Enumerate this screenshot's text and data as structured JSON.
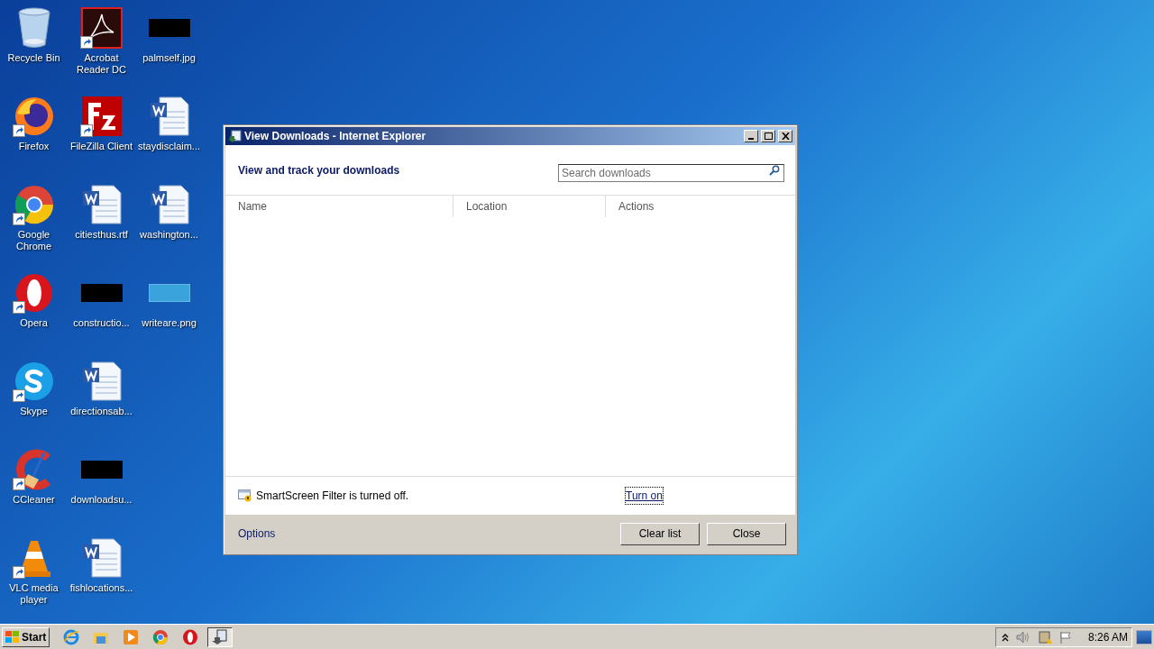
{
  "desktop_icons": [
    {
      "label": "Recycle Bin",
      "kind": "recycle",
      "shortcut": false
    },
    {
      "label": "Firefox",
      "kind": "firefox",
      "shortcut": true
    },
    {
      "label": "Google Chrome",
      "kind": "chrome",
      "shortcut": true
    },
    {
      "label": "Opera",
      "kind": "opera",
      "shortcut": true
    },
    {
      "label": "Skype",
      "kind": "skype",
      "shortcut": true
    },
    {
      "label": "CCleaner",
      "kind": "ccleaner",
      "shortcut": true
    },
    {
      "label": "VLC media player",
      "kind": "vlc",
      "shortcut": true
    },
    {
      "label": "Acrobat Reader DC",
      "kind": "acrobat",
      "shortcut": true
    },
    {
      "label": "FileZilla Client",
      "kind": "filezilla",
      "shortcut": true
    },
    {
      "label": "citiesthus.rtf",
      "kind": "word",
      "shortcut": false
    },
    {
      "label": "constructio...",
      "kind": "dark-image",
      "shortcut": false
    },
    {
      "label": "directionsab...",
      "kind": "word",
      "shortcut": false
    },
    {
      "label": "downloadsu...",
      "kind": "dark-image",
      "shortcut": false
    },
    {
      "label": "fishlocations...",
      "kind": "word",
      "shortcut": false
    },
    {
      "label": "palmself.jpg",
      "kind": "dark-image",
      "shortcut": false
    },
    {
      "label": "staydisclaim...",
      "kind": "word",
      "shortcut": false
    },
    {
      "label": "washington...",
      "kind": "word",
      "shortcut": false
    },
    {
      "label": "writeare.png",
      "kind": "light-image",
      "shortcut": false
    }
  ],
  "window": {
    "title": "View Downloads - Internet Explorer",
    "heading": "View and track your downloads",
    "search": {
      "placeholder": "Search downloads"
    },
    "columns": [
      "Name",
      "Location",
      "Actions"
    ],
    "notice": {
      "text": "SmartScreen Filter is turned off.",
      "link": "Turn on"
    },
    "options_link": "Options",
    "buttons": [
      "Clear list",
      "Close"
    ]
  },
  "taskbar": {
    "start": "Start",
    "pinned": [
      {
        "kind": "ie",
        "active": false
      },
      {
        "kind": "folder",
        "active": false
      },
      {
        "kind": "media",
        "active": false
      },
      {
        "kind": "chrome",
        "active": false
      },
      {
        "kind": "opera",
        "active": false
      },
      {
        "kind": "downloads",
        "active": true
      }
    ],
    "clock": "8:26 AM"
  }
}
